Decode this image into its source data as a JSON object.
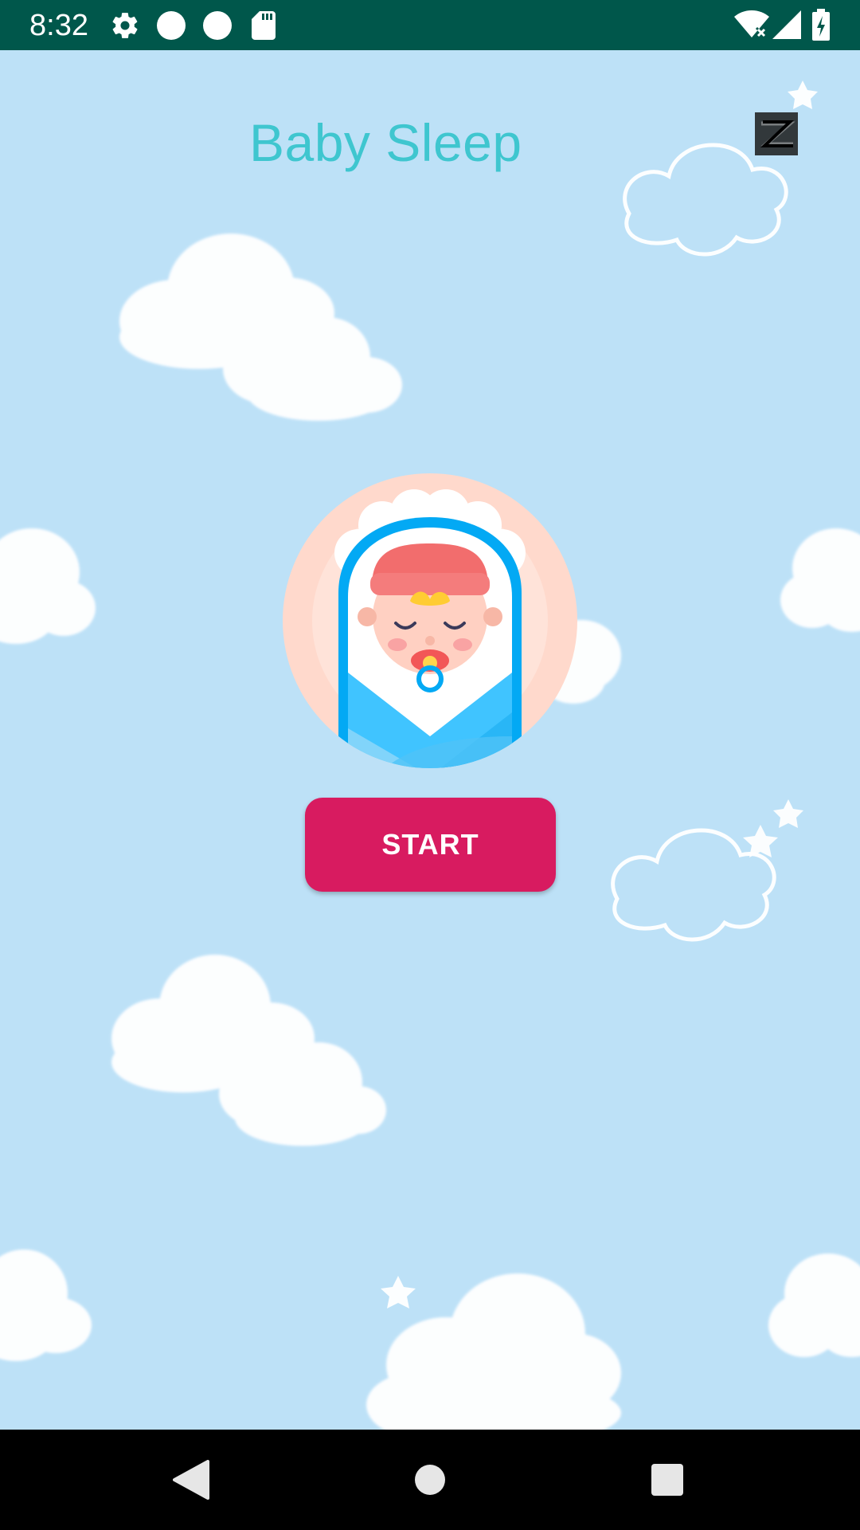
{
  "status_bar": {
    "time": "8:32",
    "icons": [
      "settings-icon",
      "notification-dot-icon",
      "notification-dot-icon",
      "sd-card-icon",
      "wifi-icon",
      "signal-icon",
      "battery-charging-icon"
    ]
  },
  "app": {
    "title": "Baby Sleep",
    "start_label": "START",
    "icons": [
      "sleep-zzz-icon",
      "sleeping-baby-illustration"
    ]
  },
  "colors": {
    "status_bar": "#00574b",
    "background": "#bde1f7",
    "title": "#3fc6cf",
    "button": "#d81b60"
  },
  "nav_bar": {
    "icons": [
      "back-icon",
      "home-icon",
      "recents-icon"
    ]
  }
}
